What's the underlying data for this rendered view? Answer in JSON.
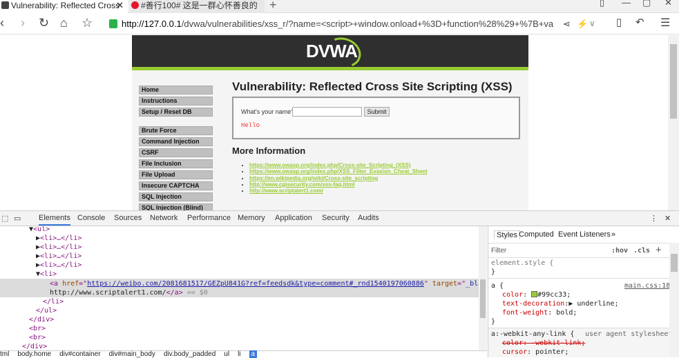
{
  "browser": {
    "tabs": [
      {
        "label": "Vulnerability: Reflected Cross"
      },
      {
        "label": "#善行100# 这是一群心怀善良的"
      }
    ],
    "new_tab": "+",
    "url_host": "http://127.0.0.1",
    "url_rest": "/dvwa/vulnerabilities/xss_r/?name=<script>+window.onload+%3D+function%28%29+%7B+va"
  },
  "dvwa": {
    "logo": "DVWA",
    "menu_top": [
      "Home",
      "Instructions",
      "Setup / Reset DB"
    ],
    "menu_vulns": [
      "Brute Force",
      "Command Injection",
      "CSRF",
      "File Inclusion",
      "File Upload",
      "Insecure CAPTCHA",
      "SQL Injection",
      "SQL Injection (Blind)"
    ],
    "title": "Vulnerability: Reflected Cross Site Scripting (XSS)",
    "form": {
      "label": "What's your name?",
      "input_value": "",
      "submit": "Submit"
    },
    "output": "Hello",
    "more_info_title": "More Information",
    "links": [
      "https://www.owasp.org/index.php/Cross-site_Scripting_(XSS)",
      "https://www.owasp.org/index.php/XSS_Filter_Evasion_Cheat_Sheet",
      "https://en.wikipedia.org/wiki/Cross-site_scripting",
      "http://www.cgisecurity.com/xss-faq.html",
      "http://www.scriptalert1.com/"
    ],
    "accent": "#99cc33"
  },
  "devtools": {
    "tabs": [
      "Elements",
      "Console",
      "Sources",
      "Network",
      "Performance",
      "Memory",
      "Application",
      "Security",
      "Audits"
    ],
    "href": "https://weibo.com/2081681517/GEZpU841G?ref=feedsdk&type=comment#_rnd1540197060886",
    "target": "_blank",
    "link_text": "http://www.scriptalert1.com/",
    "dollar": "== $0",
    "breadcrumbs": [
      "tml",
      "body.home",
      "div#container",
      "div#main_body",
      "div.body_padded",
      "ul",
      "li",
      "a"
    ],
    "styles": {
      "tabs": [
        "Styles",
        "Computed",
        "Event Listeners",
        "»"
      ],
      "filter": "Filter",
      "hov": ":hov",
      "cls": ".cls",
      "plus": "+",
      "element_style": "element.style {",
      "close": "}",
      "a_rule": "a {",
      "a_source": "main.css:18",
      "color_prop": "color",
      "color_val": "#99cc33;",
      "td_prop": "text-decoration",
      "td_val": "underline;",
      "fw_prop": "font-weight",
      "fw_val": "bold;",
      "ua_rule": "a:-webkit-any-link {",
      "ua_source": "user agent stylesheet",
      "ua_color": "color: -webkit-link;",
      "cursor_prop": "cursor",
      "cursor_val": "pointer;"
    }
  }
}
